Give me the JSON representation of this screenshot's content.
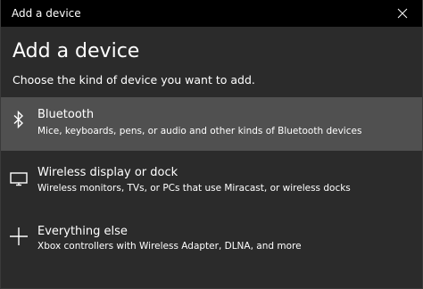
{
  "window": {
    "title": "Add a device",
    "close_icon": "close-icon"
  },
  "page": {
    "heading": "Add a device",
    "subtitle": "Choose the kind of device you want to add."
  },
  "options": [
    {
      "icon": "bluetooth-icon",
      "label": "Bluetooth",
      "description": "Mice, keyboards, pens, or audio and other kinds of Bluetooth devices",
      "selected": true
    },
    {
      "icon": "monitor-icon",
      "label": "Wireless display or dock",
      "description": "Wireless monitors, TVs, or PCs that use Miracast, or wireless docks",
      "selected": false
    },
    {
      "icon": "plus-icon",
      "label": "Everything else",
      "description": "Xbox controllers with Wireless Adapter, DLNA, and more",
      "selected": false
    }
  ],
  "colors": {
    "titlebar": "#000000",
    "background": "#2b2b2b",
    "selected_row": "#505050",
    "text": "#ffffff"
  }
}
